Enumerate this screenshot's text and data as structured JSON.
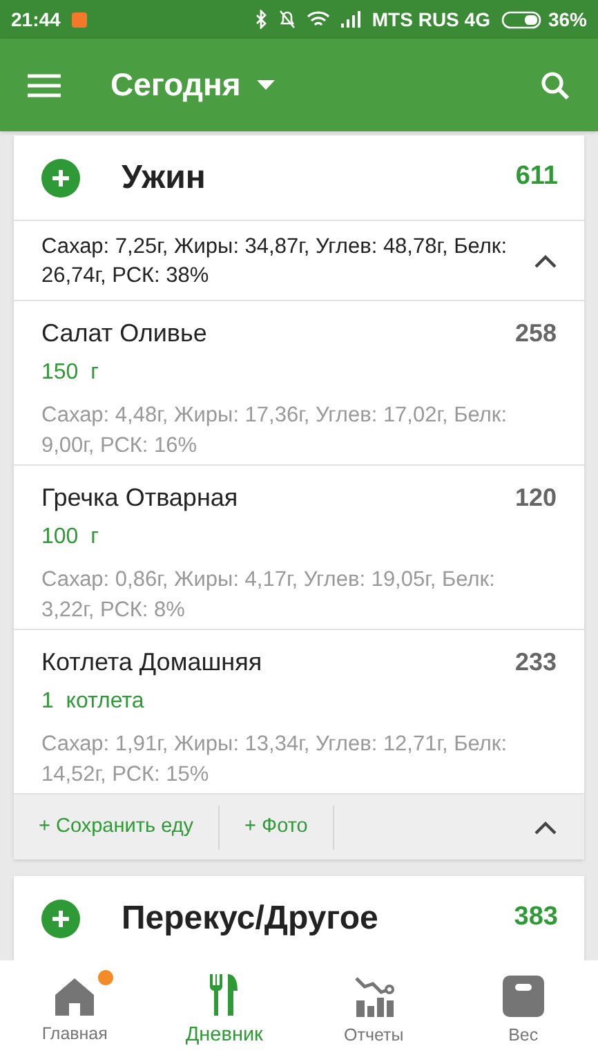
{
  "status_bar": {
    "time": "21:44",
    "carrier": "MTS RUS 4G",
    "battery": "36%"
  },
  "app_bar": {
    "title": "Сегодня"
  },
  "meals": [
    {
      "title": "Ужин",
      "calories": "611",
      "summary": "Сахар: 7,25г, Жиры: 34,87г, Углев: 48,78г, Белк: 26,74г, РСК: 38%",
      "items": [
        {
          "name": "Салат Оливье",
          "amount": "150  г",
          "calories": "258",
          "nutrition": "Сахар: 4,48г, Жиры: 17,36г, Углев: 17,02г, Белк: 9,00г, РСК: 16%"
        },
        {
          "name": "Гречка Отварная",
          "amount": "100  г",
          "calories": "120",
          "nutrition": "Сахар: 0,86г, Жиры: 4,17г, Углев: 19,05г, Белк: 3,22г, РСК: 8%"
        },
        {
          "name": "Котлета Домашняя",
          "amount": "1  котлета",
          "calories": "233",
          "nutrition": "Сахар: 1,91г, Жиры: 13,34г, Углев: 12,71г, Белк: 14,52г, РСК: 15%"
        }
      ],
      "actions": [
        "+ Сохранить еду",
        "+ Фото"
      ]
    },
    {
      "title": "Перекус/Другое",
      "calories": "383"
    }
  ],
  "nav": [
    {
      "label": "Главная",
      "selected": false,
      "notification": true
    },
    {
      "label": "Дневник",
      "selected": true,
      "notification": false
    },
    {
      "label": "Отчеты",
      "selected": false,
      "notification": false
    },
    {
      "label": "Вес",
      "selected": false,
      "notification": false
    }
  ]
}
